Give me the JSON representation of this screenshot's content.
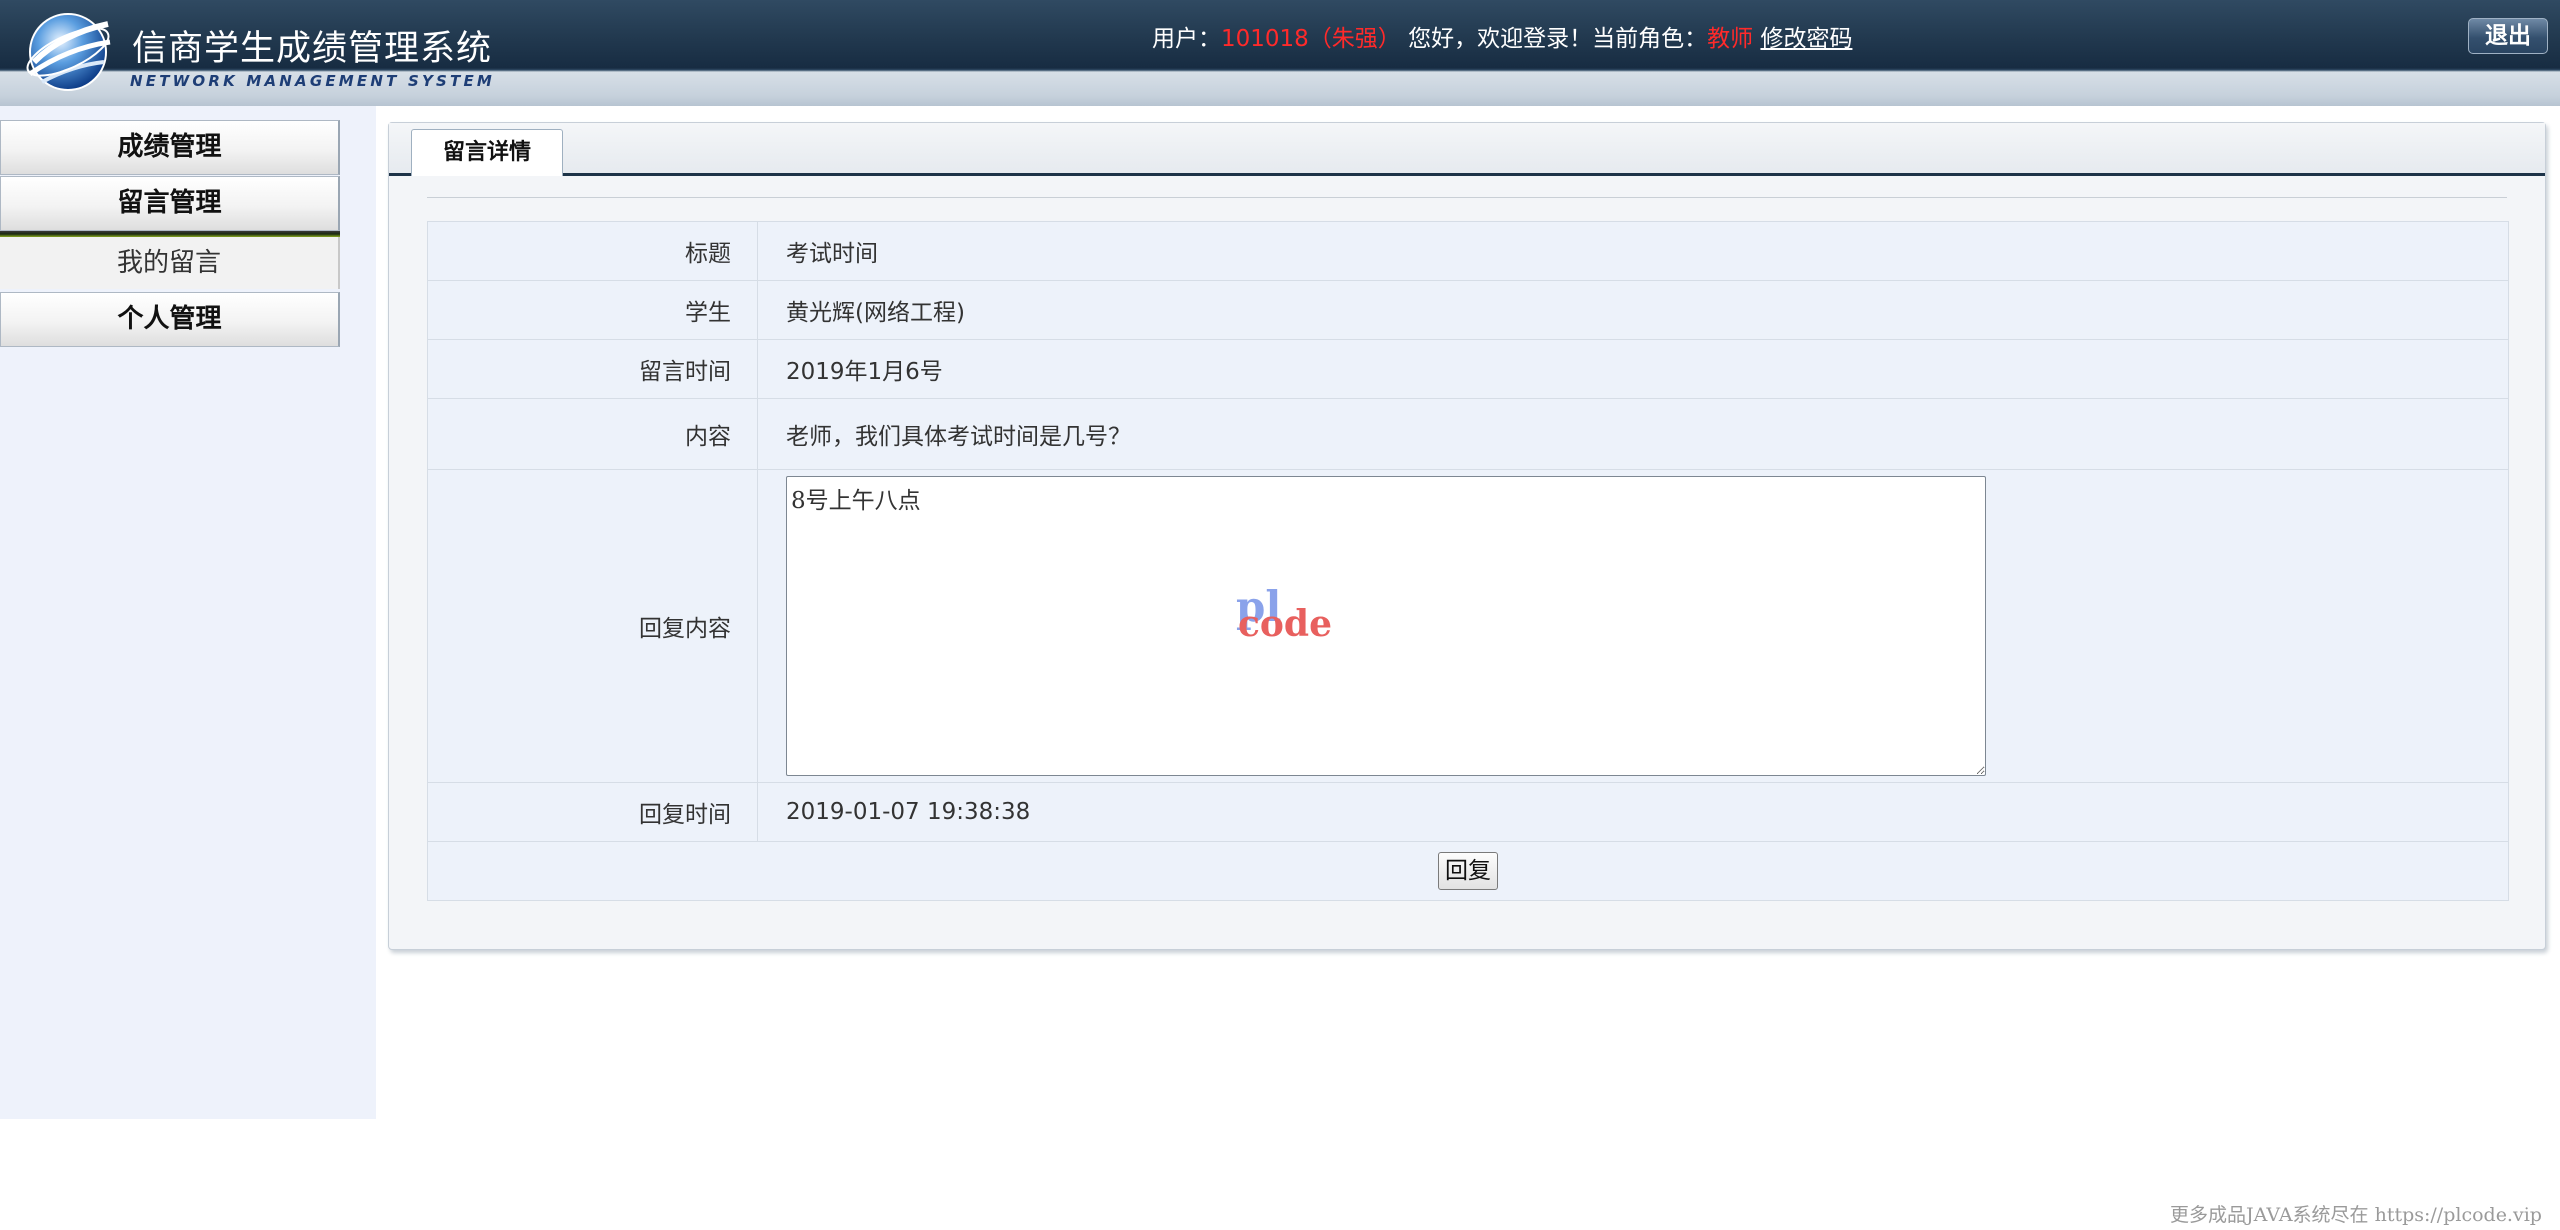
{
  "header": {
    "app_title": "信商学生成绩管理系统",
    "app_subtitle": "NETWORK MANAGEMENT SYSTEM",
    "user_label": "用户：",
    "user_value": "101018（朱强）",
    "welcome": "您好，欢迎登录！当前角色：",
    "role": "教师",
    "change_password": "修改密码",
    "logout": "退出"
  },
  "sidebar": {
    "menu": [
      "成绩管理",
      "留言管理",
      "个人管理"
    ],
    "submenu_item": "我的留言"
  },
  "tab_label": "留言详情",
  "detail": {
    "title_label": "标题",
    "title_value": "考试时间",
    "student_label": "学生",
    "student_value": "黄光辉(网络工程)",
    "time_label": "留言时间",
    "time_value": "2019年1月6号",
    "content_label": "内容",
    "content_value": "老师，我们具体考试时间是几号？",
    "reply_label": "回复内容",
    "reply_value": "8号上午八点",
    "reply_time_label": "回复时间",
    "reply_time_value": "2019-01-07 19:38:38",
    "reply_button": "回复"
  },
  "watermark": {
    "top": "pl",
    "bottom": "code"
  },
  "footer_note": "更多成品JAVA系统尽在 https://plcode.vip",
  "colors": {
    "header_dark": "#1e3347",
    "highlight_red": "#ff2a2a",
    "sidebar_bg": "#eef2fb",
    "table_bg": "#edf2fa"
  }
}
